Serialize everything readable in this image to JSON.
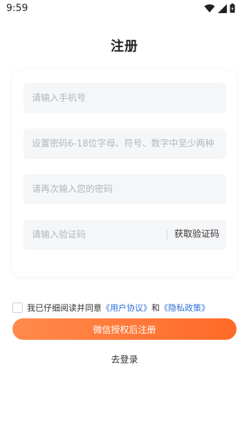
{
  "status_bar": {
    "time": "9:59",
    "icons": [
      "wifi-icon",
      "signal-icon",
      "battery-icon"
    ]
  },
  "page": {
    "title": "注册"
  },
  "form": {
    "phone_placeholder": "请输入手机号",
    "password_placeholder": "设置密码6-18位字母、符号、数字中至少两种",
    "confirm_placeholder": "请再次输入您的密码",
    "code_placeholder": "请输入验证码",
    "get_code_label": "获取验证码"
  },
  "agreement": {
    "prefix": "我已仔细阅读并同意",
    "user_agreement": "《用户协议》",
    "conjunction": "和",
    "privacy_policy": "《隐私政策》",
    "checked": false
  },
  "actions": {
    "register_label": "微信授权后注册",
    "login_label": "去登录"
  },
  "colors": {
    "accent_start": "#ff8a4c",
    "accent_end": "#ff6a28",
    "link": "#2f6fd6",
    "field_bg": "#f5f6f8"
  }
}
